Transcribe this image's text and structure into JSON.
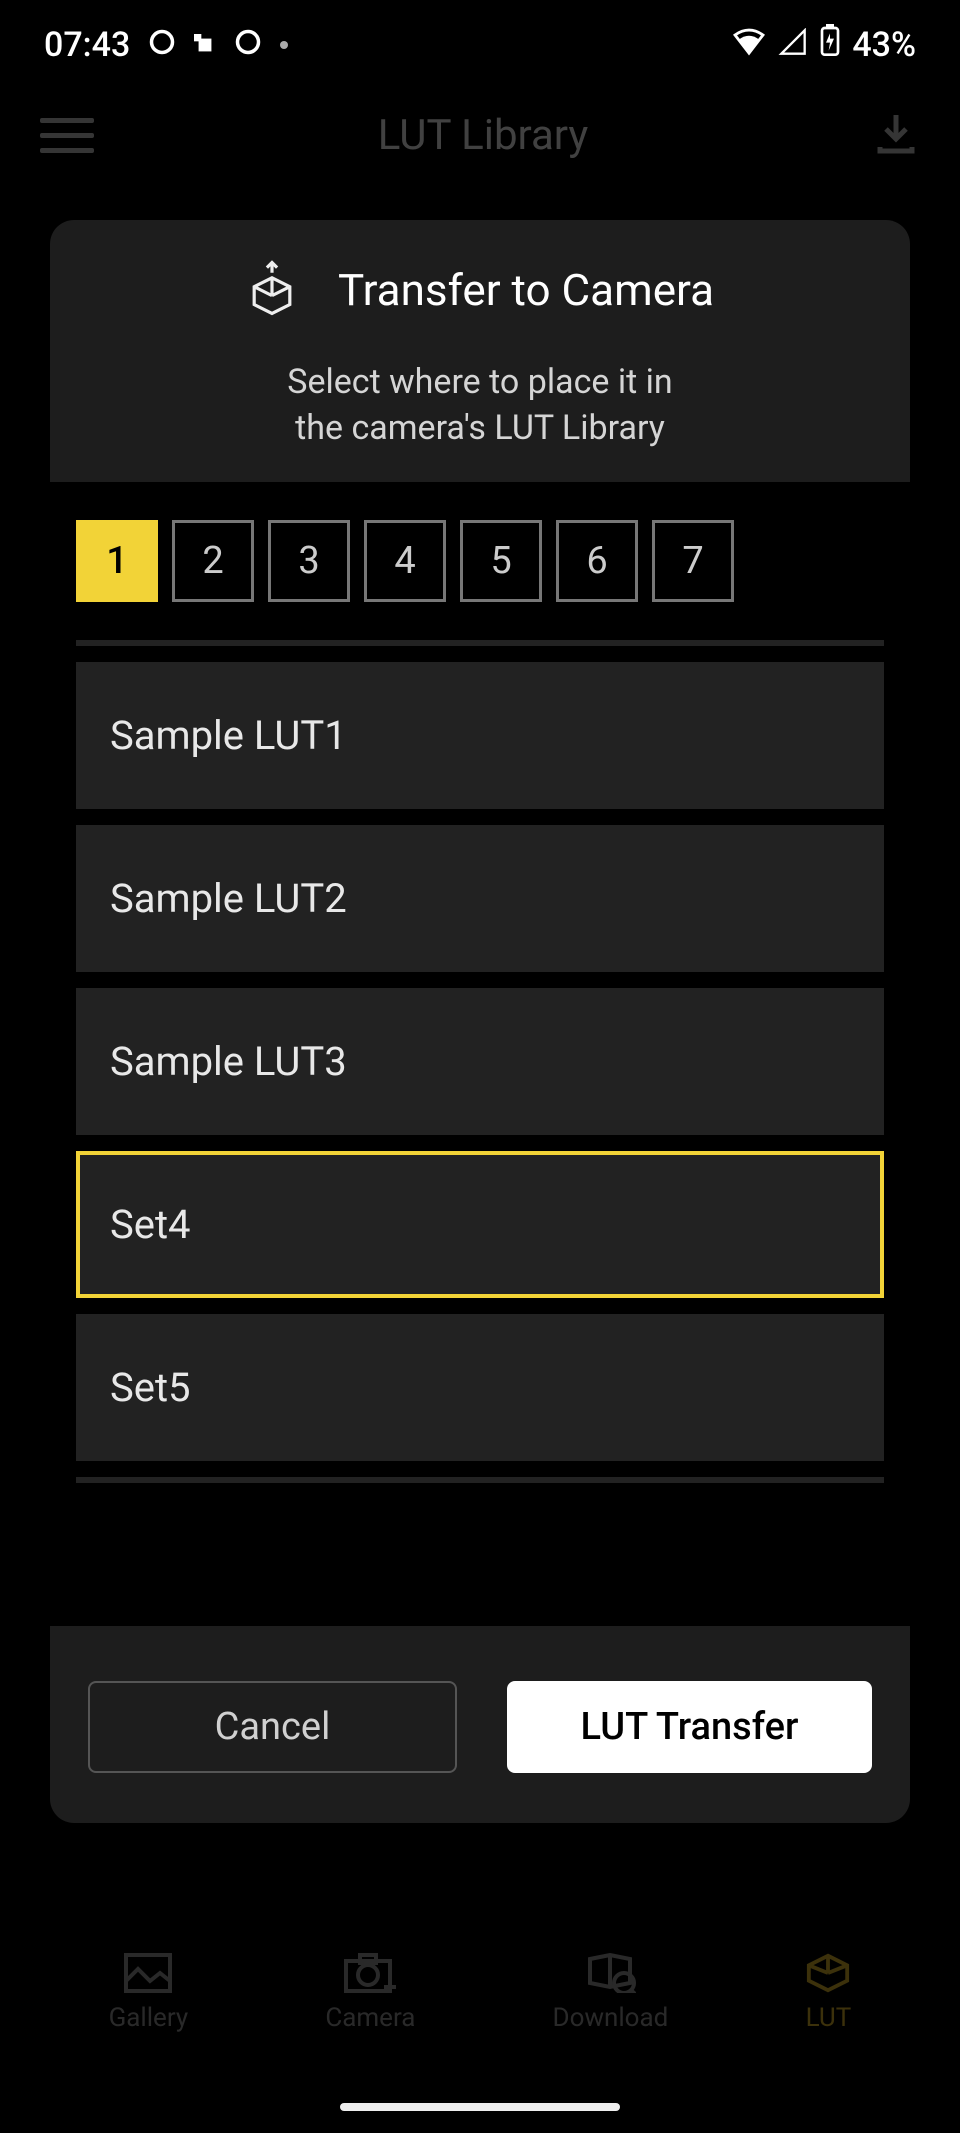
{
  "status": {
    "time": "07:43",
    "battery": "43%"
  },
  "app": {
    "title": "LUT Library"
  },
  "modal": {
    "title": "Transfer to Camera",
    "subtitle_line1": "Select where to place it in",
    "subtitle_line2": "the camera's LUT Library",
    "tabs": [
      "1",
      "2",
      "3",
      "4",
      "5",
      "6",
      "7"
    ],
    "active_tab": "1",
    "items": [
      {
        "label": "Sample LUT1",
        "selected": false
      },
      {
        "label": "Sample LUT2",
        "selected": false
      },
      {
        "label": "Sample LUT3",
        "selected": false
      },
      {
        "label": "Set4",
        "selected": true
      },
      {
        "label": "Set5",
        "selected": false
      }
    ],
    "cancel": "Cancel",
    "confirm": "LUT Transfer"
  },
  "nav": {
    "gallery": "Gallery",
    "camera": "Camera",
    "download": "Download",
    "lut": "LUT"
  }
}
